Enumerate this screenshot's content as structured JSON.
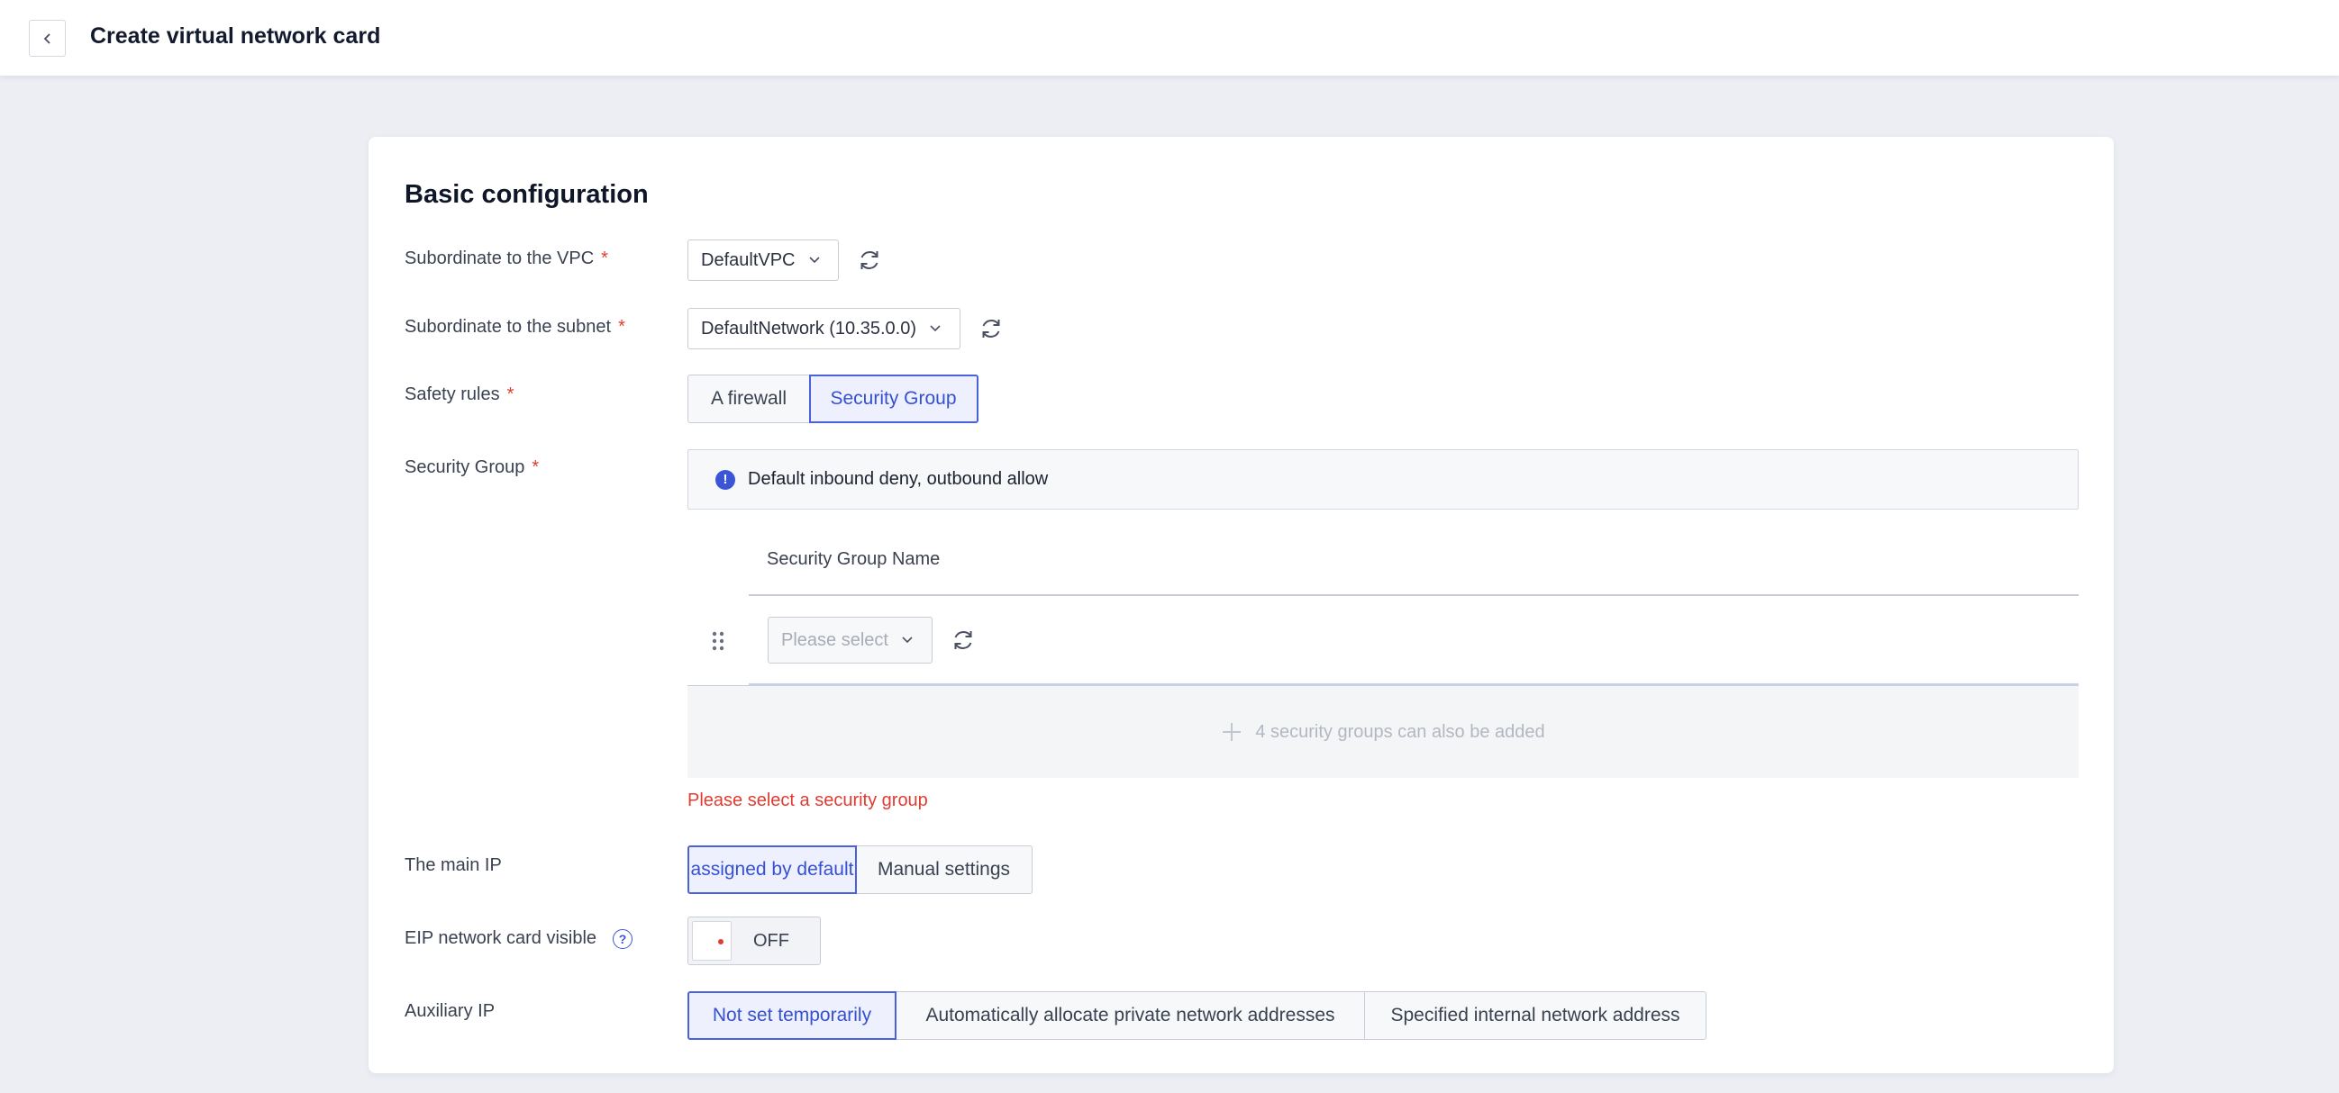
{
  "header": {
    "title": "Create virtual network card",
    "back_icon": "chevron-left-icon"
  },
  "form": {
    "section_title": "Basic configuration",
    "vpc": {
      "label": "Subordinate to the VPC",
      "required": "*",
      "value": "DefaultVPC"
    },
    "subnet": {
      "label": "Subordinate to the subnet",
      "required": "*",
      "value": "DefaultNetwork (10.35.0.0)"
    },
    "safety_rules": {
      "label": "Safety rules",
      "required": "*",
      "options": [
        "A firewall",
        "Security Group"
      ],
      "selected": "Security Group"
    },
    "security_group": {
      "label": "Security Group",
      "required": "*",
      "notice": "Default inbound deny, outbound allow",
      "column_header": "Security Group Name",
      "select_placeholder": "Please select",
      "add_text": "4 security groups can also be added",
      "error": "Please select a security group"
    },
    "main_ip": {
      "label": "The main IP",
      "options": [
        "assigned by default",
        "Manual settings"
      ],
      "selected": "assigned by default"
    },
    "eip_visible": {
      "label": "EIP network card visible",
      "help": "?",
      "state": "OFF"
    },
    "auxiliary_ip": {
      "label": "Auxiliary IP",
      "options": [
        "Not set temporarily",
        "Automatically allocate private network addresses",
        "Specified internal network address"
      ],
      "selected": "Not set temporarily"
    }
  },
  "colors": {
    "accent": "#3b55d6",
    "error": "#e03c31",
    "background": "#eceef4"
  }
}
